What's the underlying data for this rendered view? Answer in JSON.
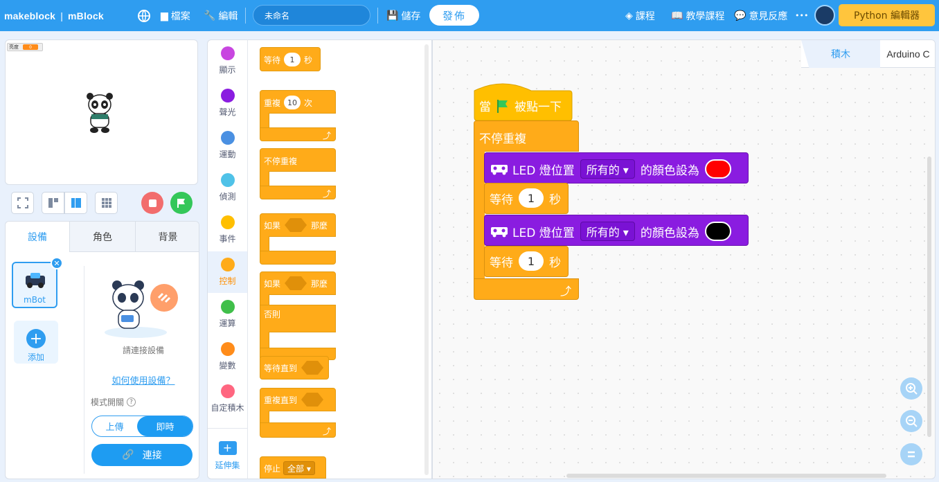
{
  "topbar": {
    "brand": "makeblock",
    "product": "mBlock",
    "file": "檔案",
    "edit": "編輯",
    "project_name": "未命名",
    "save": "儲存",
    "publish": "發佈",
    "course": "課程",
    "teaching": "教學課程",
    "feedback": "意見反應",
    "more": "•••",
    "python_editor": "Python 編輯器"
  },
  "stage": {
    "brightness_label": "亮度",
    "brightness_value": "0"
  },
  "device_panel": {
    "tabs": [
      "設備",
      "角色",
      "背景"
    ],
    "device_name": "mBot",
    "add_label": "添加",
    "connect_prompt": "請連接設備",
    "how_to_link": "如何使用設備？",
    "mode_label": "模式開關",
    "mode_upload": "上傳",
    "mode_live": "即時",
    "connect_button": "連接"
  },
  "categories": [
    {
      "label": "顯示",
      "color": "#c846e0"
    },
    {
      "label": "聲光",
      "color": "#8a1ce0"
    },
    {
      "label": "運動",
      "color": "#4a90e2"
    },
    {
      "label": "偵測",
      "color": "#4fc2e8"
    },
    {
      "label": "事件",
      "color": "#ffbf00"
    },
    {
      "label": "控制",
      "color": "#ffab19"
    },
    {
      "label": "運算",
      "color": "#40bf4a"
    },
    {
      "label": "變數",
      "color": "#ff8c1a"
    },
    {
      "label": "自定積木",
      "color": "#ff6680"
    }
  ],
  "extension_label": "延伸集",
  "palette": {
    "wait": "等待",
    "wait_val": "1",
    "sec": "秒",
    "repeat": "重複",
    "repeat_val": "10",
    "times": "次",
    "forever": "不停重複",
    "if": "如果",
    "then": "那麼",
    "if2": "如果",
    "then2": "那麼",
    "else": "否則",
    "wait_until": "等待直到",
    "repeat_until": "重複直到",
    "stop": "停止",
    "stop_opt": "全部 ▾"
  },
  "workspace": {
    "tab_blocks": "積木",
    "tab_code": "Arduino C",
    "when": "當",
    "clicked": "被點一下",
    "forever": "不停重複",
    "led1_a": "LED 燈位置",
    "led1_opt": "所有的 ▾",
    "led1_b": "的顏色設為",
    "led1_color": "#ff0000",
    "wait1": "等待",
    "wait1_val": "1",
    "wait1_unit": "秒",
    "led2_a": "LED 燈位置",
    "led2_opt": "所有的 ▾",
    "led2_b": "的顏色設為",
    "led2_color": "#000000",
    "wait2": "等待",
    "wait2_val": "1",
    "wait2_unit": "秒"
  }
}
